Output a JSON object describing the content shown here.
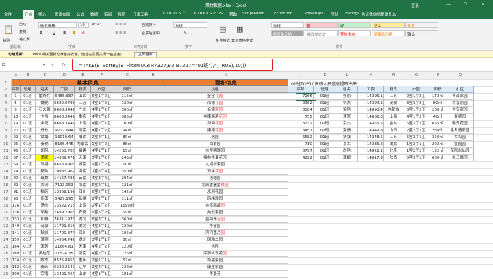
{
  "titlebar": {
    "filename": "素材数据.xlsx",
    "app": "Excel",
    "user": "登录",
    "share": "共享"
  },
  "tabs": [
    "文件",
    "开始",
    "插入",
    "页面布局",
    "公式",
    "数据",
    "审阅",
    "视图",
    "开发工具",
    "KUTOOLS ™",
    "KUTOOLS PLUS",
    "帮助",
    "ScriptAddin",
    "EFunction",
    "PowerUps",
    "团队",
    "xlwings",
    "告诉我你想要做什么"
  ],
  "ribbon": {
    "clipboard": [
      "剪切",
      "复制",
      "格式刷"
    ],
    "paste": "粘贴",
    "font_name": "微软雅黑",
    "font_size": "10",
    "wrap": "自动换行",
    "merge": "合并后居中",
    "number_format": "常规",
    "pct": "%",
    "comma": ",",
    "cond_format": "条件格式",
    "as_table": "套用表格格式",
    "styles": [
      [
        "常规",
        "差",
        "好",
        "适中",
        "计算"
      ],
      [
        "检查单元格",
        "解释性文本",
        "警告文本",
        "链接单元格",
        "输出"
      ]
    ],
    "groups": [
      "剪贴板",
      "字体",
      "对齐方式",
      "数字",
      "样式"
    ]
  },
  "msgbar": {
    "label": "可用更新",
    "text": "Office 相关更新已准备好安装，但首先需要关闭一些应用。",
    "button": "立即更新"
  },
  "formula": {
    "name_box": "J3",
    "fx": "fx",
    "text": "=TAKE(ETSortBy(ETFilters(A3:H7327,B3:B7327=\"01班\"),4,TRUE),10,))"
  },
  "columns": [
    "A",
    "B",
    "C",
    "D",
    "E",
    "F",
    "G",
    "H",
    "I",
    "J",
    "K",
    "L",
    "M",
    "N",
    "O",
    "P",
    "Q"
  ],
  "rows": [
    "1",
    "2",
    "3",
    "4",
    "5",
    "6",
    "7",
    "8",
    "9",
    "10",
    "11",
    "12",
    "13",
    "14",
    "15",
    "16",
    "17",
    "18",
    "19",
    "20",
    "21",
    "22",
    "23",
    "24",
    "25",
    "26",
    "27",
    "28",
    "29"
  ],
  "left": {
    "section1": "基本信息",
    "section2": "面积信息",
    "headers": [
      "序号",
      "班组",
      "姓名",
      "工资",
      "籍贯",
      "户型",
      "面积",
      "小区"
    ],
    "rows": [
      [
        "1",
        "01班",
        "雷秀兵",
        "6485.687",
        "山西",
        "5室1厅2卫",
        "115㎡",
        "金宝",
        "花园"
      ],
      [
        "5",
        "01班",
        "魏艳",
        "6682.0798",
        "江苏",
        "4室1厅2卫",
        "120㎡",
        "海德",
        "花园"
      ],
      [
        "9",
        "01班",
        "石大甜",
        "8668.3447",
        "广东",
        "4室1厅2卫",
        "300㎡",
        "合德",
        "家园"
      ],
      [
        "18",
        "01班",
        "卞丽",
        "8668.3447",
        "重庆",
        "4室2厅2卫",
        "385㎡",
        "中南海滨",
        "花园"
      ],
      [
        "19",
        "01班",
        "余庭",
        "8668.3447",
        "上海",
        "4室2厅1卫",
        "100㎡",
        "华海",
        "花园"
      ],
      [
        "20",
        "01班",
        "丹玫",
        "9722.644",
        "河南",
        "4室1厅2卫",
        "94㎡",
        "康德",
        "花园"
      ],
      [
        "22",
        "01班",
        "钛娟",
        "13010.64",
        "陕西",
        "2室2厅1卫",
        "80㎡",
        "信园",
        ""
      ],
      [
        "25",
        "01班",
        "秦艳",
        "8166.445",
        "内蒙古",
        "1室2厅2卫",
        "86㎡",
        "伯爵园",
        ""
      ],
      [
        "46",
        "01班",
        "胡风",
        "14253.786",
        "福建",
        "4室1厅1卫",
        "15㎡",
        "东华明珠园",
        ""
      ],
      [
        "67",
        "01班",
        "蒲军",
        "14309.471",
        "天津",
        "5室1厅2卫",
        "245㎡",
        "梅林华夏花园",
        ""
      ],
      [
        "69",
        "01班",
        "洪娟",
        "8653.8905",
        "湖南",
        "9室1厅2卫",
        "10㎡",
        "九娱树家园",
        ""
      ],
      [
        "74",
        "01班",
        "斯数",
        "10983.969",
        "海南",
        "7室3厅4卫",
        "350㎡",
        "万丰",
        "花园"
      ],
      [
        "80",
        "01班",
        "班数",
        "14157.483",
        "云南",
        "4室3厅2卫",
        "204㎡",
        "信德园",
        ""
      ],
      [
        "89",
        "01班",
        "贾涛",
        "7113.953",
        "海南",
        "6室2厅1卫",
        "121㎡",
        "北辰香麓望",
        "楼园"
      ],
      [
        "91",
        "01班",
        "柏芳",
        "13559.197",
        "四川",
        "6室2厅2卫",
        "142㎡",
        "永利花园",
        ""
      ],
      [
        "98",
        "01班",
        "伍勇",
        "5427.195",
        "新疆",
        "2室2厅1卫",
        "111㎡",
        "风格雅园",
        ""
      ],
      [
        "116",
        "01班",
        "汤杰",
        "13522.213",
        "上海",
        "2室1厅2卫",
        "1699㎡",
        "金晖丽晶",
        "园"
      ],
      [
        "130",
        "01班",
        "邹艳",
        "7699.2963",
        "安徽",
        "6室3厅2卫",
        "19㎡",
        "美欣家园",
        ""
      ],
      [
        "133",
        "01班",
        "和静",
        "7631.1976",
        "湖北",
        "6室3厅1卫",
        "360㎡",
        "金海岸",
        "花园"
      ],
      [
        "140",
        "01班",
        "马敏",
        "11791.318",
        "湖北",
        "4室2厅1卫",
        "120㎡",
        "华富园",
        ""
      ],
      [
        "141",
        "01班",
        "秋颖",
        "11700.874",
        "四川",
        "4室2厅1卫",
        "105㎡",
        "滨河嘉月",
        "园"
      ],
      [
        "159",
        "01班",
        "藩刚",
        "14554.742",
        "湖北",
        "3室1厅1卫",
        "80㎡",
        "凤和二园",
        ""
      ],
      [
        "164",
        "01班",
        "宋芳",
        "11664.81",
        "天津",
        "4室2厅2卫",
        "120㎡",
        "怡园",
        ""
      ],
      [
        "169",
        "01班",
        "黄桂芝",
        "11524.35",
        "河南",
        "4室2厅1卫",
        "126㎡",
        "荣源大观花",
        "园"
      ],
      [
        "174",
        "01班",
        "牧杰",
        "8575.8456",
        "重庆",
        "2室1厅1卫",
        "52㎡",
        "华福家园",
        ""
      ],
      [
        "182",
        "01班",
        "骆芳",
        "6230.2549",
        "辽宁",
        "2室2厅1卫",
        "122㎡",
        "康庄家园",
        ""
      ],
      [
        "190",
        "01班",
        "宗雨",
        "13491.464",
        "山东",
        "4室1厅1卫",
        "181㎡",
        "华景苑",
        ""
      ]
    ]
  },
  "right": {
    "title": "01班TOP10高薪人员信息提取出来",
    "headers": [
      "序号",
      "班组",
      "姓名",
      "工资",
      "籍贯",
      "户型",
      "面积",
      "小区"
    ],
    "rows": [
      [
        "7166",
        "01班",
        "强丽",
        "14996.1",
        "江苏",
        "2室1厅2卫",
        "142㎡",
        "丰泽家园"
      ],
      [
        "2962",
        "01班",
        "杭杰",
        "14994.1",
        "安徽",
        "3室3厅2卫",
        "80㎡",
        "洪福丽园"
      ],
      [
        "3084",
        "01班",
        "骆艳",
        "14993.4",
        "内蒙古",
        "6室1厅2卫",
        "260㎡",
        "大安家园"
      ],
      [
        "755",
        "01班",
        "速军",
        "14966.6",
        "上海",
        "4室1厅2卫",
        "40㎡",
        "海德园"
      ],
      [
        "3132",
        "01班",
        "宗杰",
        "14955.5",
        "吉林",
        "6室3厅2卫",
        "655㎡",
        "鹏安花园"
      ],
      [
        "3451",
        "01班",
        "夏倩",
        "14949.8",
        "山西",
        "2室2厅2卫",
        "59㎡",
        "毛名苑家园"
      ],
      [
        "6582",
        "01班",
        "扶强",
        "14948.5",
        "江苏",
        "5室3厅1卫",
        "350㎡",
        "世和园"
      ],
      [
        "710",
        "01班",
        "喜军",
        "14936.2",
        "湖北",
        "1室2厅1卫",
        "202㎡",
        "宜园园"
      ],
      [
        "3797",
        "01班",
        "尚艳",
        "14922.1",
        "北京",
        "1室2厅1卫",
        "152㎡",
        "花园水仙园"
      ],
      [
        "4222",
        "01班",
        "蒲娜",
        "14917.9",
        "陕西",
        "5室3厅1卫",
        "600㎡",
        "凯马嘉园"
      ]
    ]
  }
}
